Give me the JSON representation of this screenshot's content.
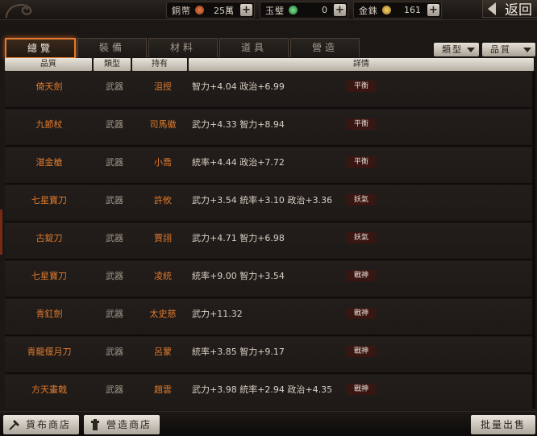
{
  "resources": [
    {
      "label": "銅幣",
      "value": "25萬",
      "coin_color": "#c0522a"
    },
    {
      "label": "玉璧",
      "value": "0",
      "coin_color": "#2ea34a"
    },
    {
      "label": "金銖",
      "value": "161",
      "coin_color": "#d8a12a"
    }
  ],
  "back_label": "返回",
  "tabs": [
    "總覽",
    "裝備",
    "材料",
    "道具",
    "營造"
  ],
  "active_tab": 0,
  "sort_buttons": [
    "類型",
    "品質"
  ],
  "columns": [
    "品質",
    "類型",
    "持有",
    "詳情"
  ],
  "items": [
    {
      "name": "倚天劍",
      "type": "武器",
      "owner": "沮授",
      "detail": "智力+4.04  政治+6.99",
      "badge": "平衡"
    },
    {
      "name": "九節杖",
      "type": "武器",
      "owner": "司馬徽",
      "detail": "武力+4.33  智力+8.94",
      "badge": "平衡"
    },
    {
      "name": "湛金槍",
      "type": "武器",
      "owner": "小喬",
      "detail": "統率+4.44  政治+7.72",
      "badge": "平衡"
    },
    {
      "name": "七星寶刀",
      "type": "武器",
      "owner": "許攸",
      "detail": "武力+3.54  統率+3.10  政治+3.36",
      "badge": "妖氣"
    },
    {
      "name": "古錠刀",
      "type": "武器",
      "owner": "賈詡",
      "detail": "武力+4.71  智力+6.98",
      "badge": "妖氣"
    },
    {
      "name": "七星寶刀",
      "type": "武器",
      "owner": "凌統",
      "detail": "統率+9.00  智力+3.54",
      "badge": "戰神"
    },
    {
      "name": "青釭劍",
      "type": "武器",
      "owner": "太史慈",
      "detail": "武力+11.32",
      "badge": "戰神"
    },
    {
      "name": "青龍偃月刀",
      "type": "武器",
      "owner": "呂蒙",
      "detail": "統率+3.85  智力+9.17",
      "badge": "戰神"
    },
    {
      "name": "方天畫戟",
      "type": "武器",
      "owner": "趙雲",
      "detail": "武力+3.98  統率+2.94  政治+4.35",
      "badge": "戰神"
    }
  ],
  "bottom_buttons": {
    "currency_shop": "貨布商店",
    "build_shop": "營造商店",
    "bulk_sell": "批量出售"
  }
}
